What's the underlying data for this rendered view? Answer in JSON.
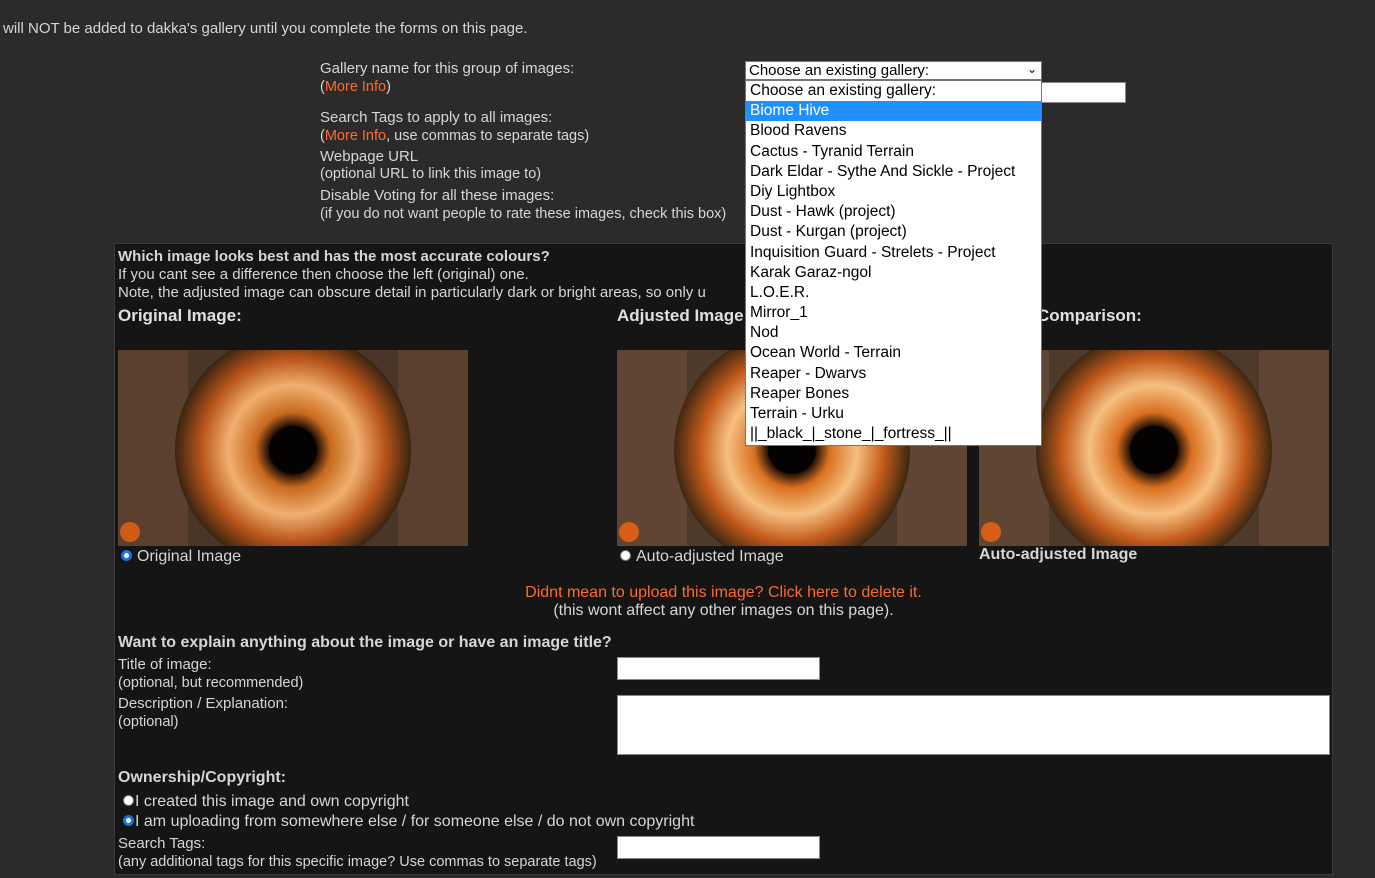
{
  "notice": "will NOT be added to dakka's gallery until you complete the forms on this page.",
  "gallery": {
    "label": "Gallery name for this group of images:",
    "more_info": "More Info",
    "select_value": "Choose an existing gallery:",
    "options": [
      "Choose an existing gallery:",
      "Biome Hive",
      "Blood Ravens",
      "Cactus - Tyranid Terrain",
      "Dark Eldar - Sythe And Sickle - Project",
      "Diy Lightbox",
      "Dust - Hawk (project)",
      "Dust - Kurgan (project)",
      "Inquisition Guard - Strelets - Project",
      "Karak Garaz-ngol",
      "L.O.E.R.",
      "Mirror_1",
      "Nod",
      "Ocean World - Terrain",
      "Reaper - Dwarvs",
      "Reaper Bones",
      "Terrain - Urku",
      "||_black_|_stone_|_fortress_||"
    ],
    "highlighted_option": "Biome Hive"
  },
  "tags": {
    "label": "Search Tags to apply to all images:",
    "more_info": "More Info",
    "hint": ", use commas to separate tags)"
  },
  "webpage": {
    "label": "Webpage URL",
    "hint": "(optional URL to link this image to)"
  },
  "voting": {
    "label": "Disable Voting for all these images:",
    "hint": "(if you do not want people to rate these images, check this box)"
  },
  "panel": {
    "question": "Which image looks best and has the most accurate colours?",
    "line1": "If you cant see a difference then choose the left (original) one.",
    "line2": "Note, the adjusted image can obscure detail in particularly dark or bright areas, so only u",
    "original_head": "Original Image:",
    "adjusted_head": "Adjusted Image:",
    "comparison_head": "Comparison:",
    "original_radio": "Original Image",
    "adjusted_radio": "Auto-adjusted Image",
    "comparison_caption": "Auto-adjusted Image",
    "delete_link": "Didnt mean to upload this image? Click here to delete it.",
    "delete_note": "(this wont affect any other images on this page).",
    "explain_head": "Want to explain anything about the image or have an image title?",
    "title_label": "Title of image:",
    "title_hint": "(optional, but recommended)",
    "desc_label": "Description / Explanation:",
    "desc_hint": "(optional)",
    "ownership_head": "Ownership/Copyright:",
    "own_option1": "I created this image and own copyright",
    "own_option2": "I am uploading from somewhere else / for someone else / do not own copyright",
    "tags_label": "Search Tags:",
    "tags_hint": "(any additional tags for this specific image? Use commas to separate tags)"
  },
  "colors": {
    "background": "#2b2b2b",
    "panel": "#151515",
    "link": "#ff6a2a",
    "highlight": "#1e90ff"
  }
}
